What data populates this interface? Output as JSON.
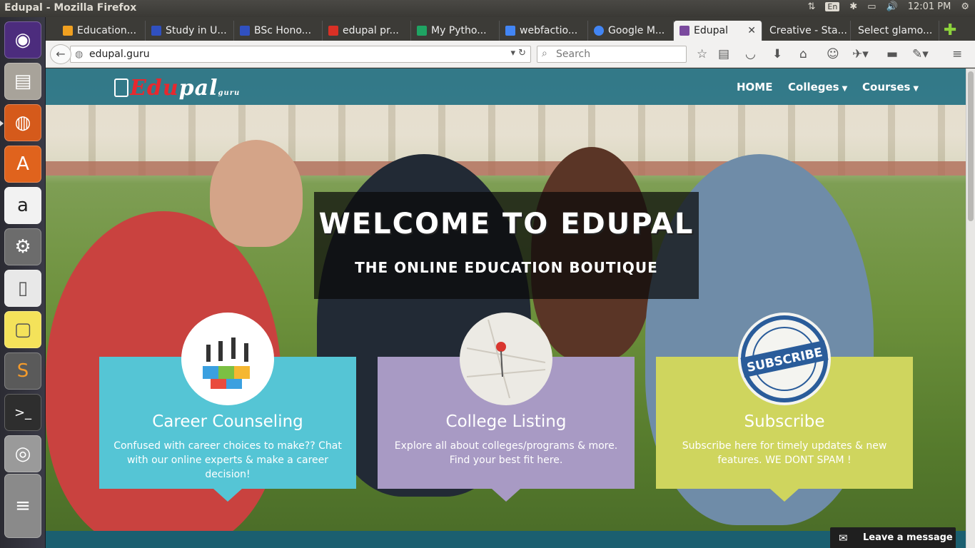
{
  "window": {
    "title": "Edupal - Mozilla Firefox"
  },
  "tray": {
    "lang": "En",
    "time": "12:01 PM"
  },
  "launcher": {
    "items": [
      "ubuntu-dash",
      "files",
      "firefox",
      "software-center",
      "amazon",
      "system-settings",
      "libreoffice",
      "sticky-notes",
      "sublime-text",
      "terminal",
      "disk",
      "workspaces"
    ]
  },
  "tabs": [
    {
      "label": "Education...",
      "color": "#f0a020"
    },
    {
      "label": "Study in U...",
      "color": "#3050c0"
    },
    {
      "label": "BSc Hono...",
      "color": "#3050c0"
    },
    {
      "label": "edupal pr...",
      "color": "#d93025"
    },
    {
      "label": "My Pytho...",
      "color": "#1fa463"
    },
    {
      "label": "webfactio...",
      "color": "#4285f4"
    },
    {
      "label": "Google M...",
      "color": "#4285f4"
    },
    {
      "label": "Edupal",
      "color": "#7b4a9e"
    },
    {
      "label": "Creative - Sta...",
      "color": ""
    },
    {
      "label": "Select glamo...",
      "color": ""
    }
  ],
  "navbar": {
    "url": "edupal.guru",
    "search_placeholder": "Search"
  },
  "site": {
    "logo_red": "Edu",
    "logo_white": "pal",
    "logo_sub": "guru",
    "nav": {
      "home": "HOME",
      "colleges": "Colleges",
      "courses": "Courses"
    }
  },
  "hero": {
    "title": "WELCOME TO EDUPAL",
    "subtitle": "THE ONLINE EDUCATION BOUTIQUE"
  },
  "cards": [
    {
      "title": "Career Counseling",
      "text": "Confused with career choices to make?? Chat with our online experts & make a career decision!",
      "color": "#55c5d5"
    },
    {
      "title": "College Listing",
      "text": "Explore all about colleges/programs & more. Find your best fit here.",
      "color": "#a89ac4"
    },
    {
      "title": "Subscribe",
      "text": "Subscribe here for timely updates & new features. WE DONT SPAM !",
      "color": "#cfd55e",
      "badge": "SUBSCRIBE"
    }
  ],
  "chat": {
    "label": "Leave a message"
  }
}
